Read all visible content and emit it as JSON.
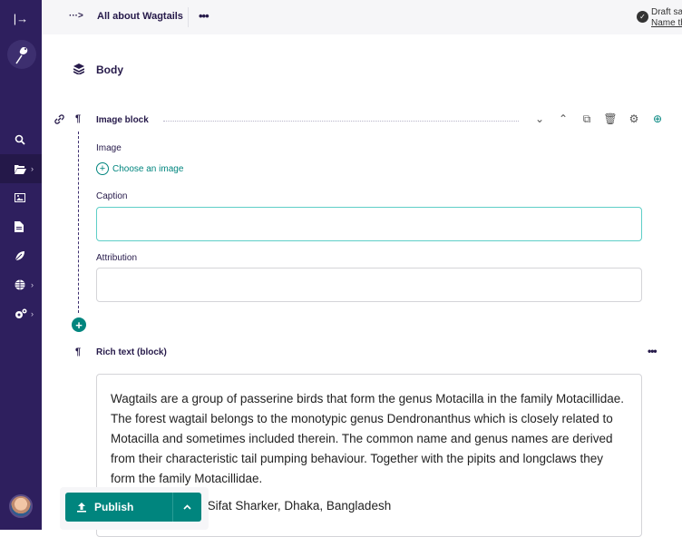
{
  "sidebar": {
    "collapse_icon": "|→",
    "items": [
      {
        "name": "search",
        "icon": "🔍",
        "has_submenu": false,
        "active": false
      },
      {
        "name": "pages",
        "icon": "📂",
        "has_submenu": true,
        "active": true
      },
      {
        "name": "images",
        "icon": "🖼",
        "has_submenu": false,
        "active": false
      },
      {
        "name": "documents",
        "icon": "📄",
        "has_submenu": false,
        "active": false
      },
      {
        "name": "snippets",
        "icon": "🍃",
        "has_submenu": false,
        "active": false
      },
      {
        "name": "sites",
        "icon": "🌐",
        "has_submenu": true,
        "active": false
      },
      {
        "name": "settings",
        "icon": "⚙",
        "has_submenu": true,
        "active": false
      }
    ],
    "chevron": "›"
  },
  "header": {
    "breadcrumb_more": "···>",
    "title": "All about Wagtails",
    "actions_more": "•••",
    "status_line1": "Draft saved",
    "status_line2": "Name this version"
  },
  "body_section": {
    "title": "Body"
  },
  "image_block": {
    "title": "Image block",
    "image_label": "Image",
    "choose_image": "Choose an image",
    "caption_label": "Caption",
    "caption_value": "",
    "attribution_label": "Attribution",
    "attribution_value": ""
  },
  "rich_text_block": {
    "title": "Rich text (block)",
    "more": "•••",
    "paragraphs": [
      "Wagtails are a group of passerine birds that form the genus Motacilla in the family Motacillidae. The forest wagtail belongs to the monotypic genus Dendronanthus which is closely related to Motacilla and sometimes included therein. The common name and genus names are derived from their characteristic tail pumping behaviour. Together with the pipits and longclaws they form the family Motacillidae.",
      "Photographed by Sifat Sharker, Dhaka, Bangladesh"
    ]
  },
  "footer": {
    "publish_label": "Publish",
    "publish_toggle": "^"
  },
  "colors": {
    "sidebar_bg": "#2e1f5e",
    "primary": "#00857e",
    "text": "#261a4a",
    "focus_border": "#5ecfc7"
  }
}
